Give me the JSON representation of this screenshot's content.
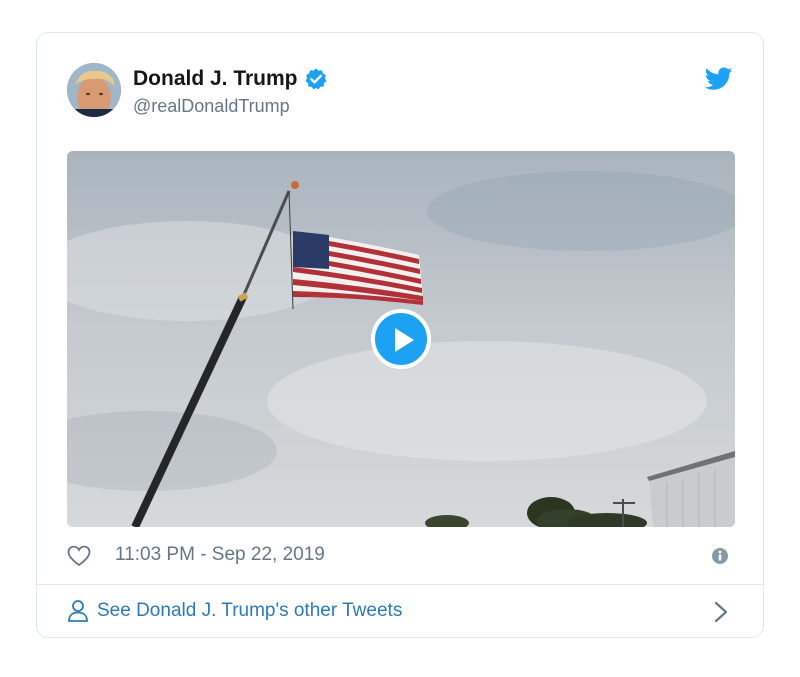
{
  "tweet": {
    "author_name": "Donald J. Trump",
    "author_handle": "@realDonaldTrump",
    "timestamp": "11:03 PM - Sep 22, 2019",
    "footer_link": "See Donald J. Trump's other Tweets"
  },
  "icons": {
    "verified": "verified-badge-icon",
    "brand": "twitter-bird-icon",
    "like": "heart-icon",
    "info": "info-icon",
    "profile": "person-icon",
    "more": "chevron-right-icon",
    "play": "play-icon"
  },
  "colors": {
    "brand_blue": "#1da1f2",
    "link_blue": "#2b7bb9",
    "text_primary": "#14171a",
    "text_secondary": "#657786",
    "border": "#e1e8ed"
  }
}
